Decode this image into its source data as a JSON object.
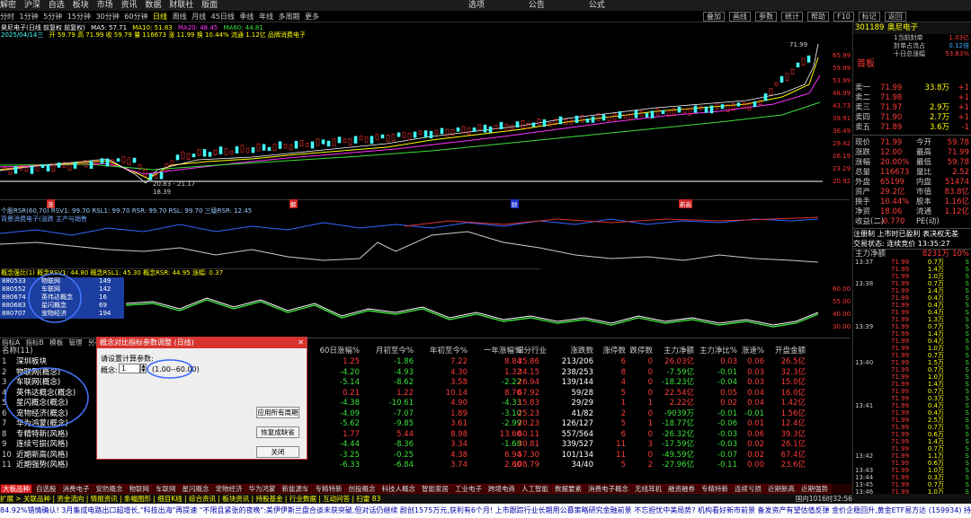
{
  "menu": [
    "解密",
    "沪深",
    "自选",
    "板块",
    "市场",
    "资讯",
    "数据",
    "财联社",
    "版面"
  ],
  "menu_right": [
    "选项",
    "公告",
    "公式"
  ],
  "period_tabs": [
    "分时",
    "1分钟",
    "5分钟",
    "15分钟",
    "30分钟",
    "60分钟",
    "日线",
    "周线",
    "月线",
    "45日线",
    "季线",
    "年线",
    "多周期",
    "更多"
  ],
  "right_buttons": [
    "叠加",
    "画线",
    "参数",
    "统计",
    "帮助",
    "F10",
    "标记",
    "返回"
  ],
  "chart_header": {
    "name": "昊尼电子(日线 前复权 前复权)",
    "ma5": "MA5: 57.71",
    "ma10": "MA10: 51.83",
    "ma20": "MA20: 48.45",
    "ma60": "MA60: 44.81",
    "date": "2025/04/14三",
    "vol": "开 59.79 高 71.99 收 59.79 量 116673 涨 11.99 换 10.44% 流通 1.12亿 品牌消费电子"
  },
  "price_axis": [
    "65.99",
    "59.99",
    "53.99",
    "48.99",
    "43.73",
    "39.91",
    "36.49",
    "29.42",
    "26.19",
    "23.29",
    "20.92",
    "18.82"
  ],
  "peak_label": "71.99",
  "low_label": "20.83 - 21.17",
  "low2": "18.39",
  "rsr_header": "个股RSR(60,70)  RSV1: 99.70  RSL1: 99.70  RSR: 99.70  RSL: 99.70  三级RSR: 12.45",
  "rsr_note": "背景消费电子(涨跌 主产与销售",
  "date_markers": [
    "涨",
    "解",
    "财",
    "新高"
  ],
  "rsr2_header": "概念强比(1) 概念RSV1: 44.80  概念RSL1: 45.30  概念RSR: 44.95  涨幅: 0.37",
  "rsr2_axis": [
    "60.00",
    "55.00",
    "40.00",
    "30.00"
  ],
  "code_list": [
    {
      "code": "880533",
      "name": "物联网",
      "v": "149"
    },
    {
      "code": "880552",
      "name": "车联网",
      "v": "142"
    },
    {
      "code": "880674",
      "name": "英伟达概念",
      "v": "16"
    },
    {
      "code": "880683",
      "name": "星闪概念",
      "v": "69"
    },
    {
      "code": "880707",
      "name": "宠物经济",
      "v": "194"
    }
  ],
  "stock": {
    "code": "301189",
    "name": "奥尼电子",
    "board": "首板"
  },
  "rp_top": [
    [
      "1当前封单",
      "1.03亿"
    ],
    [
      "封单占流占",
      "0.12倍"
    ],
    [
      "十日总涨幅",
      "53.63%"
    ]
  ],
  "orders": [
    [
      "卖一",
      "71.99",
      "33.8万",
      "+1"
    ],
    [
      "卖二",
      "71.98",
      "",
      "+1"
    ],
    [
      "卖三",
      "71.97",
      "2.9万",
      "+1"
    ],
    [
      "卖四",
      "71.90",
      "2.7万",
      "+1"
    ],
    [
      "卖五",
      "71.89",
      "3.6万",
      "-1"
    ]
  ],
  "quote": [
    [
      "现价",
      "71.99",
      "今开",
      "59.78"
    ],
    [
      "涨跌",
      "12.00",
      "最高",
      "71.99"
    ],
    [
      "涨幅",
      "20.00%",
      "最低",
      "59.78"
    ],
    [
      "总量",
      "116673",
      "量比",
      "2.52"
    ],
    [
      "外盘",
      "65199",
      "内盘",
      "51474"
    ],
    [
      "资产",
      "29.2亿",
      "市值",
      "83.8亿"
    ],
    [
      "换手",
      "10.44%",
      "股本",
      "1.16亿"
    ],
    [
      "净资",
      "18.06",
      "流通",
      "1.12亿"
    ],
    [
      "收益(二)",
      "-0.770",
      "PE(动)",
      ""
    ]
  ],
  "notice": "注册制 上市时已盈利 表决权无差",
  "trade_status": "交易状态: 连续竞价 13:35:27",
  "net_inflow": [
    "主力净额",
    "8231万",
    "10%"
  ],
  "ticks": [
    [
      "13:37",
      "71.99",
      "0.7万",
      "S"
    ],
    [
      "",
      "71.99",
      "1.4万",
      "S"
    ],
    [
      "",
      "71.99",
      "1.0万",
      "S"
    ],
    [
      "13:38",
      "71.99",
      "0.7万",
      "S"
    ],
    [
      "",
      "71.99",
      "1.4万",
      "S"
    ],
    [
      "",
      "71.99",
      "0.4万",
      "S"
    ],
    [
      "",
      "71.99",
      "0.4万",
      "S"
    ],
    [
      "",
      "71.99",
      "0.4万",
      "S"
    ],
    [
      "",
      "71.99",
      "1.3万",
      "S"
    ],
    [
      "13:39",
      "71.99",
      "0.7万",
      "S"
    ],
    [
      "",
      "71.99",
      "1.4万",
      "S"
    ],
    [
      "",
      "71.99",
      "0.4万",
      "S"
    ],
    [
      "",
      "71.99",
      "1.0万",
      "S"
    ],
    [
      "",
      "71.99",
      "0.7万",
      "S"
    ],
    [
      "13:40",
      "71.99",
      "1.5万",
      "S"
    ],
    [
      "",
      "71.99",
      "0.7万",
      "S"
    ],
    [
      "",
      "71.99",
      "1.0万",
      "S"
    ],
    [
      "",
      "71.99",
      "1.4万",
      "S"
    ],
    [
      "",
      "71.99",
      "0.7万",
      "S"
    ],
    [
      "",
      "71.99",
      "0.3万",
      "S"
    ],
    [
      "13:41",
      "71.99",
      "0.4万",
      "S"
    ],
    [
      "",
      "71.99",
      "0.4万",
      "S"
    ],
    [
      "",
      "71.99",
      "2.5万",
      "S"
    ],
    [
      "",
      "71.99",
      "0.7万",
      "S"
    ],
    [
      "",
      "71.99",
      "0.6万",
      "S"
    ],
    [
      "",
      "71.99",
      "1.4万",
      "S"
    ],
    [
      "",
      "71.99",
      "0.7万",
      "S"
    ],
    [
      "13:42",
      "71.99",
      "1.1万",
      "S"
    ],
    [
      "",
      "71.99",
      "0.6万",
      "S"
    ],
    [
      "13:43",
      "71.99",
      "1.0万",
      "S"
    ],
    [
      "13:44",
      "71.99",
      "0.3万",
      "S"
    ],
    [
      "13:45",
      "71.99",
      "0.7万",
      "S"
    ],
    [
      "13:46",
      "71.99",
      "1.0万",
      "S"
    ]
  ],
  "table_header": [
    "名称(11)",
    "60日涨幅%",
    "月初至今%",
    "年初至今%",
    "一年涨幅%",
    "细分行业",
    "涨跌数",
    "涨停数",
    "跌停数",
    "主力净额",
    "主力净比%",
    "涨速%",
    "开盘金额"
  ],
  "table_tabs": [
    "指标A",
    "指标B",
    "模板",
    "管理",
    "另存"
  ],
  "table_rows": [
    [
      "深圳板块",
      "1.25",
      "-1.86",
      "7.22",
      "8.84",
      "35.86",
      "213/206",
      "6",
      "0",
      "26.03亿",
      "0.03",
      "0.06",
      "26.5亿"
    ],
    [
      "物联网(概念)",
      "-4.20",
      "-4.93",
      "4.30",
      "1.32",
      "34.15",
      "238/253",
      "8",
      "0",
      "-7.59亿",
      "-0.01",
      "0.03",
      "32.3亿"
    ],
    [
      "车联网(概念)",
      "-5.14",
      "-8.62",
      "3.58",
      "-2.22",
      "26.94",
      "139/144",
      "4",
      "0",
      "-18.23亿",
      "-0.04",
      "0.03",
      "15.0亿"
    ],
    [
      "英伟达概念(概念)",
      "0.21",
      "1.22",
      "10.14",
      "8.70",
      "67.92",
      "59/28",
      "5",
      "0",
      "22.54亿",
      "0.05",
      "0.04",
      "16.0亿"
    ],
    [
      "星闪概念(概念)",
      "-4.38",
      "-10.61",
      "4.90",
      "-4.33",
      "15.83",
      "29/29",
      "1",
      "1",
      "2.22亿",
      "0.02",
      "0.04",
      "1.42亿"
    ],
    [
      "宠物经济(概念)",
      "-4.09",
      "-7.07",
      "1.89",
      "-3.10",
      "25.23",
      "41/82",
      "2",
      "0",
      "-9039万",
      "-0.01",
      "-0.01",
      "1.56亿"
    ],
    [
      "华为鸿蒙(概念)",
      "-5.62",
      "-9.85",
      "3.61",
      "-2.99",
      "20.23",
      "126/127",
      "5",
      "1",
      "-18.77亿",
      "-0.06",
      "0.01",
      "12.4亿"
    ],
    [
      "专精特新(风格)",
      "1.77",
      "5.44",
      "8.98",
      "13.60",
      "60.11",
      "557/564",
      "6",
      "0",
      "-26.32亿",
      "-0.03",
      "0.06",
      "39.3亿"
    ],
    [
      "连续亏损(风格)",
      "-4.44",
      "-8.36",
      "3.34",
      "-1.68",
      "30.81",
      "339/527",
      "11",
      "3",
      "-17.59亿",
      "-0.03",
      "0.02",
      "26.1亿"
    ],
    [
      "近期新高(风格)",
      "-3.25",
      "-0.25",
      "4.38",
      "6.94",
      "57.30",
      "101/134",
      "11",
      "0",
      "-49.59亿",
      "-0.07",
      "0.02",
      "67.4亿"
    ],
    [
      "近期强势(风格)",
      "-6.33",
      "-6.84",
      "3.74",
      "2.60",
      "108.79",
      "34/40",
      "5",
      "2",
      "-27.96亿",
      "-0.11",
      "0.00",
      "23.6亿"
    ]
  ],
  "extra_rows": [
    [
      "0.58",
      "1914.03",
      "1.13",
      "1.17",
      "4.00",
      "0.22"
    ],
    [
      "1.05",
      "356.82",
      "1.53",
      "1.53",
      "3.63",
      "0.20"
    ]
  ],
  "dialog": {
    "title": "概念对比指标参数调整 (日线)",
    "label": "请设置计算参数:",
    "param": "概念:",
    "value": "1",
    "range": "(1.00--60.00)",
    "btn_apply": "应用所有周期",
    "btn_reset": "恢复成缺省",
    "btn_close": "关闭"
  },
  "bottom_tabs": [
    "大板品种",
    "自选股",
    "消费电子",
    "安防概念",
    "物联网",
    "车联网",
    "星闪概念",
    "宠物经济",
    "华为鸿蒙",
    "新能源车",
    "专精特新",
    "创投概念",
    "科技人概念",
    "智能家居",
    "工业电子",
    "跨境电商",
    "人工智能",
    "数据要素",
    "消费电子概念",
    "无线耳机",
    "融资融券",
    "专精特新",
    "连续亏损",
    "近期新高",
    "近期强势"
  ],
  "status_bar": "扩展 > 关联品种 | 资金流向 | 情报资讯 | 条幅图形 | 细目K线 | 综合资讯 | 板块资讯 | 持股基金 | 行业数据 | 互动问答 | 扫雷 83",
  "ticker": "84.92%错情确认!  3月集成电路出口超增长,\"科技出海\"再提速    \"不限且紧张的夜晚\":美伊伊斯兰盘合谈未获突破,但对话仍继续    剧创1575万元,获利有6个月! 上市跟踪行业长期用公募策略研究金融前景    不忘担忧中美局势? 机构看好新市前景 备发资产有望估值反弹    金价企稳回升,黄金ETF易方达 (159934) 持续获资金关注",
  "ticker_date": "国内1016时32:56"
}
